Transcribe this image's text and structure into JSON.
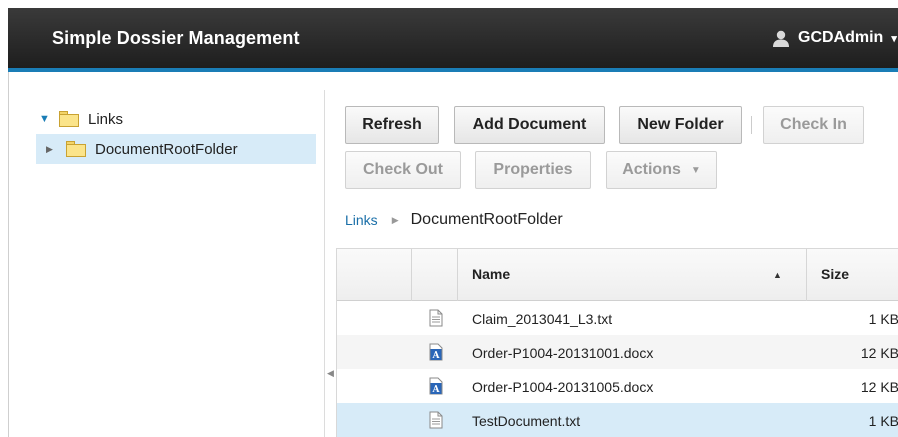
{
  "header": {
    "title": "Simple Dossier Management",
    "user": "GCDAdmin"
  },
  "tree": {
    "root_label": "Links",
    "child_label": "DocumentRootFolder"
  },
  "toolbar": {
    "refresh": "Refresh",
    "add_document": "Add Document",
    "new_folder": "New Folder",
    "check_in": "Check In",
    "check_out": "Check Out",
    "properties": "Properties",
    "actions": "Actions"
  },
  "breadcrumb": {
    "link": "Links",
    "current": "DocumentRootFolder"
  },
  "grid": {
    "columns": {
      "name": "Name",
      "size": "Size"
    },
    "rows": [
      {
        "name": "Claim_2013041_L3.txt",
        "size": "1 KB",
        "icon": "text-file-icon"
      },
      {
        "name": "Order-P1004-20131001.docx",
        "size": "12 KB",
        "icon": "word-document-icon"
      },
      {
        "name": "Order-P1004-20131005.docx",
        "size": "12 KB",
        "icon": "word-document-icon"
      },
      {
        "name": "TestDocument.txt",
        "size": "1 KB",
        "icon": "text-file-icon"
      }
    ]
  },
  "colors": {
    "header_bg": "#2b2b2b",
    "accent_stripe": "#1a7db6",
    "selection": "#d7ebf8"
  }
}
